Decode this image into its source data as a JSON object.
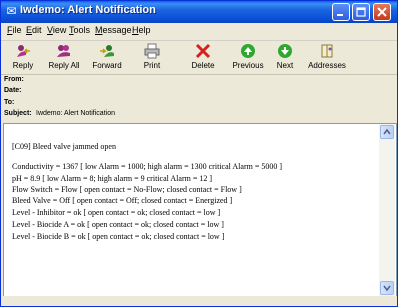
{
  "window": {
    "title": "Iwdemo: Alert Notification"
  },
  "menu": [
    "File",
    "Edit",
    "View",
    "Tools",
    "Message",
    "Help"
  ],
  "toolbar": [
    {
      "label": "Reply",
      "icon": "reply-icon"
    },
    {
      "label": "Reply All",
      "icon": "reply-all-icon"
    },
    {
      "label": "Forward",
      "icon": "forward-icon"
    },
    {
      "label": "Print",
      "icon": "print-icon"
    },
    {
      "label": "Delete",
      "icon": "delete-icon"
    },
    {
      "label": "Previous",
      "icon": "previous-icon"
    },
    {
      "label": "Next",
      "icon": "next-icon"
    },
    {
      "label": "Addresses",
      "icon": "addresses-icon"
    }
  ],
  "headers": {
    "from_label": "From:",
    "date_label": "Date:",
    "to_label": "To:",
    "subject_label": "Subject:",
    "subject": "Iwdemo: Alert Notification"
  },
  "body": {
    "lines": [
      "[C09] Bleed valve jammed open",
      "Conductivity = 1367  [ low Alarm = 1000; high alarm = 1300 critical Alarm = 5000 ]",
      "pH = 8.9  [ low Alarm = 8; high alarm = 9 critical Alarm = 12 ]",
      "Flow Switch = Flow  [ open contact = No-Flow; closed contact = Flow ]",
      "Bleed Valve = Off  [ open contact = Off; closed contact = Energized ]",
      "Level - Inhibitor = ok  [ open contact = ok; closed contact = low ]",
      "Level - Biocide A = ok  [ open contact = ok; closed contact = low ]",
      "Level - Biocide B = ok  [ open contact = ok; closed contact = low ]"
    ]
  },
  "colors": {
    "titlebar": "#0a44c4",
    "header_highlight": "#fdf4c6",
    "window_face": "#ece9d8"
  }
}
